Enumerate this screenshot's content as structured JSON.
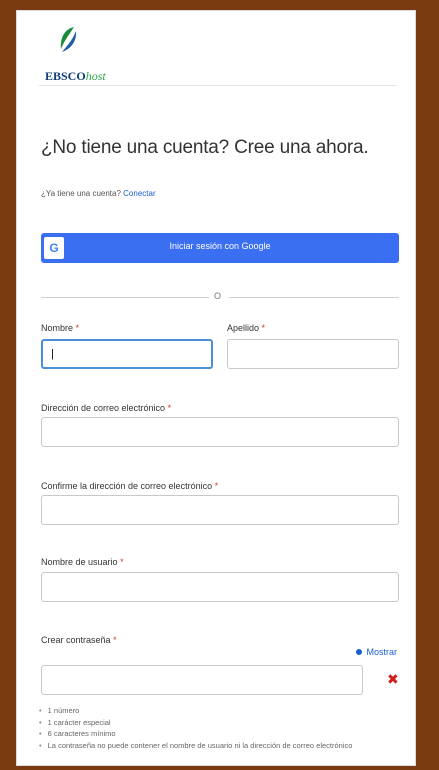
{
  "logo": {
    "brand": "EBSCO",
    "suffix": "host"
  },
  "heading": "¿No tiene una cuenta? Cree una ahora.",
  "signin": {
    "prompt": "¿Ya tiene una cuenta?",
    "link": "Conectar"
  },
  "google_button": {
    "icon": "G",
    "label": "Iniciar sesión con Google"
  },
  "separator": "O",
  "form": {
    "first_name": {
      "label": "Nombre",
      "value": "|"
    },
    "last_name": {
      "label": "Apellido",
      "value": ""
    },
    "email": {
      "label": "Dirección de correo electrónico",
      "value": ""
    },
    "email_confirm": {
      "label": "Confirme la dirección de correo electrónico",
      "value": ""
    },
    "username": {
      "label": "Nombre de usuario",
      "value": ""
    },
    "password": {
      "label": "Crear contraseña",
      "value": "",
      "show_label": "Mostrar"
    },
    "required_mark": "*"
  },
  "password_rules": [
    "1 número",
    "1 carácter especial",
    "6 caracteres mínimo",
    "La contraseña no puede contener el nombre de usuario ni la dirección de correo electrónico"
  ],
  "colors": {
    "google_blue": "#3b6ff2",
    "link": "#1a5fd1",
    "required": "#d9362e",
    "error": "#d11c1c",
    "frame_border": "#7a3b10"
  }
}
